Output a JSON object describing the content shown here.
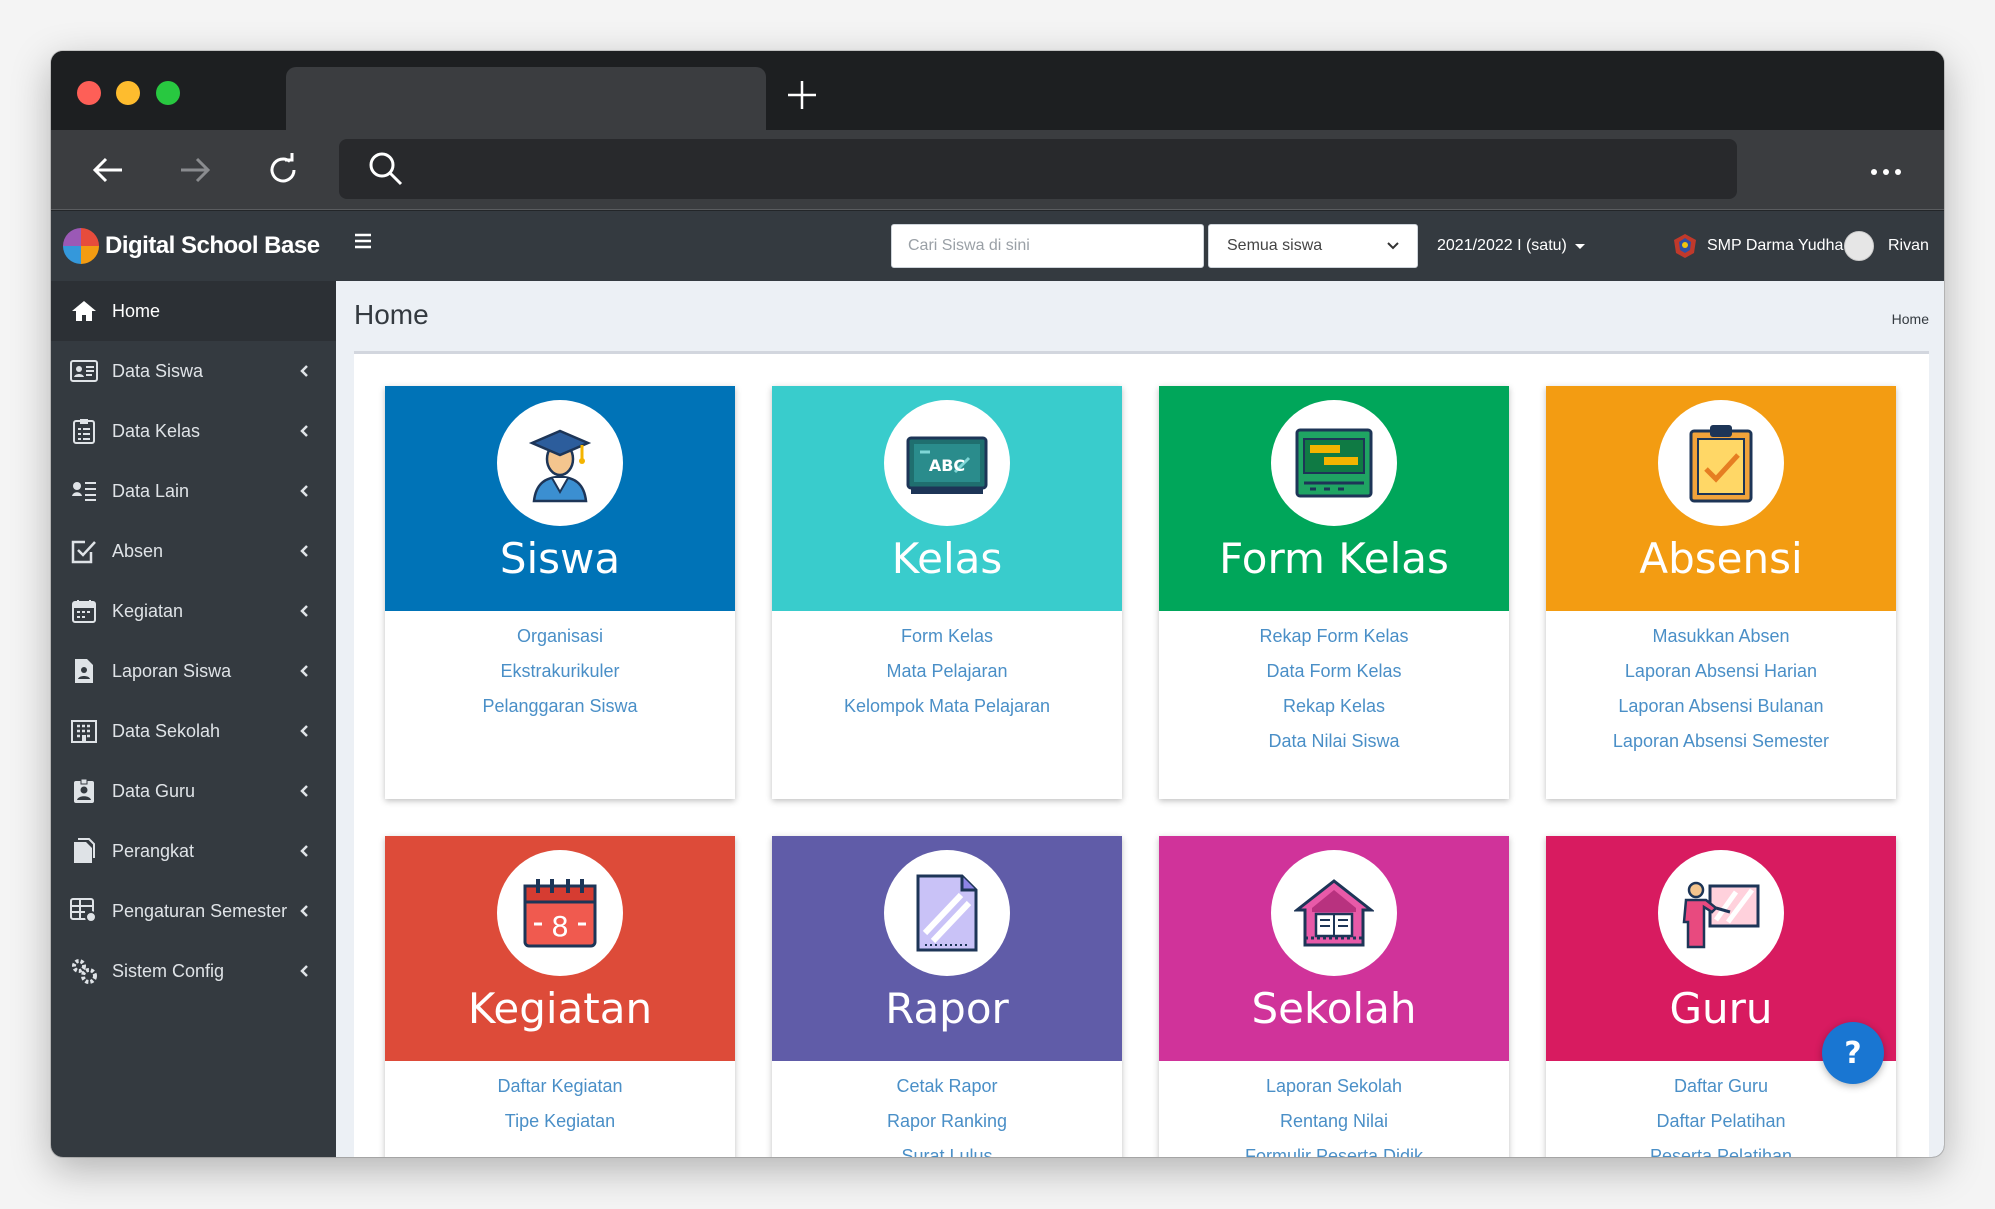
{
  "app": {
    "brand": "Digital School Base",
    "search_placeholder": "Cari Siswa di sini",
    "filter_selected": "Semua siswa",
    "period": "2021/2022 I (satu)",
    "school": "SMP Darma Yudha",
    "user": "Rivan"
  },
  "sidebar": {
    "items": [
      {
        "label": "Home",
        "icon": "home-icon"
      },
      {
        "label": "Data Siswa",
        "icon": "id-card-icon"
      },
      {
        "label": "Data Kelas",
        "icon": "clipboard-icon"
      },
      {
        "label": "Data Lain",
        "icon": "list-icon"
      },
      {
        "label": "Absen",
        "icon": "check-square-icon"
      },
      {
        "label": "Kegiatan",
        "icon": "calendar-icon"
      },
      {
        "label": "Laporan Siswa",
        "icon": "file-user-icon"
      },
      {
        "label": "Data Sekolah",
        "icon": "building-icon"
      },
      {
        "label": "Data Guru",
        "icon": "badge-icon"
      },
      {
        "label": "Perangkat",
        "icon": "documents-icon"
      },
      {
        "label": "Pengaturan Semester",
        "icon": "grid-settings-icon"
      },
      {
        "label": "Sistem Config",
        "icon": "cogs-icon"
      }
    ]
  },
  "page": {
    "title": "Home",
    "breadcrumb": "Home"
  },
  "cards": [
    {
      "title": "Siswa",
      "color": "#0073b7",
      "icon": "graduate-icon",
      "links": [
        "Organisasi",
        "Ekstrakurikuler",
        "Pelanggaran Siswa"
      ]
    },
    {
      "title": "Kelas",
      "color": "#39cccc",
      "icon": "chalkboard-abc-icon",
      "links": [
        "Form Kelas",
        "Mata Pelajaran",
        "Kelompok Mata Pelajaran"
      ]
    },
    {
      "title": "Form Kelas",
      "color": "#00a65a",
      "icon": "form-board-icon",
      "links": [
        "Rekap Form Kelas",
        "Data Form Kelas",
        "Rekap Kelas",
        "Data Nilai Siswa"
      ]
    },
    {
      "title": "Absensi",
      "color": "#f39c12",
      "icon": "clipboard-check-icon",
      "links": [
        "Masukkan Absen",
        "Laporan Absensi Harian",
        "Laporan Absensi Bulanan",
        "Laporan Absensi Semester"
      ]
    },
    {
      "title": "Kegiatan",
      "color": "#dd4b39",
      "icon": "calendar-event-icon",
      "links": [
        "Daftar Kegiatan",
        "Tipe Kegiatan"
      ]
    },
    {
      "title": "Rapor",
      "color": "#605ca8",
      "icon": "report-page-icon",
      "links": [
        "Cetak Rapor",
        "Rapor Ranking",
        "Surat Lulus"
      ]
    },
    {
      "title": "Sekolah",
      "color": "#d0339a",
      "icon": "school-building-icon",
      "links": [
        "Laporan Sekolah",
        "Rentang Nilai",
        "Formulir Peserta Didik"
      ]
    },
    {
      "title": "Guru",
      "color": "#d81b60",
      "icon": "teacher-icon",
      "links": [
        "Daftar Guru",
        "Daftar Pelatihan",
        "Peserta Pelatihan"
      ]
    }
  ]
}
